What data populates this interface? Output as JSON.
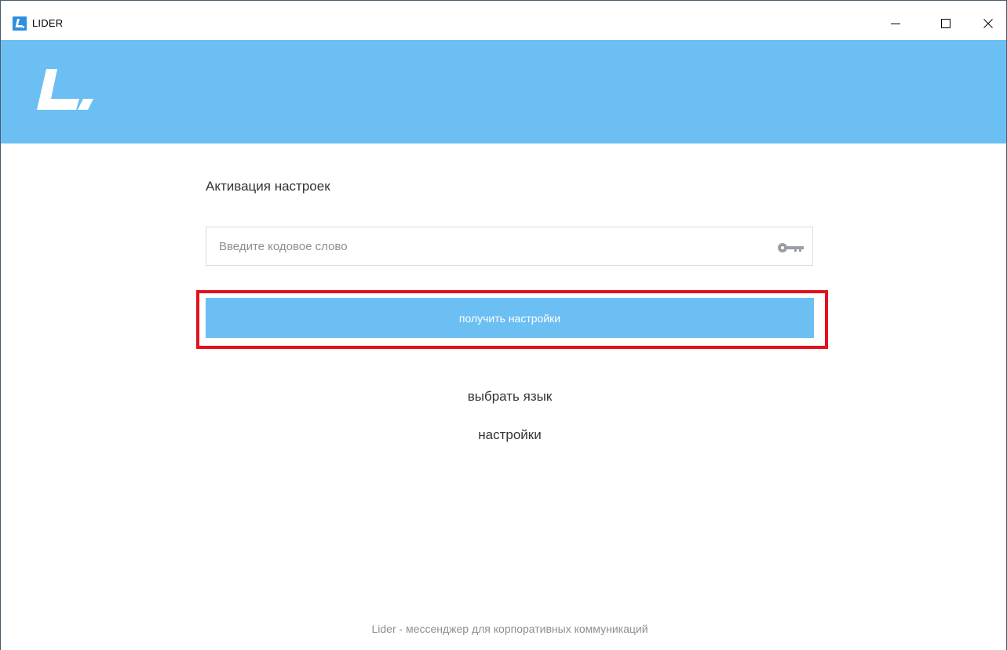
{
  "window": {
    "title": "LIDER",
    "minimize_icon": "minimize-icon",
    "maximize_icon": "maximize-icon",
    "close_icon": "close-icon"
  },
  "header": {
    "logo_icon": "lider-logo",
    "background_color": "#6bbff3"
  },
  "activation": {
    "title": "Активация настроек",
    "code_input": {
      "value": "",
      "placeholder": "Введите кодовое слово",
      "icon": "key-icon"
    },
    "get_settings_button": "получить настройки",
    "choose_language_link": "выбрать язык",
    "settings_link": "настройки"
  },
  "footer": {
    "text": "Lider - мессенджер для корпоративных коммуникаций"
  },
  "colors": {
    "accent": "#6bbff3",
    "highlight": "#e3121c",
    "text": "#333333",
    "muted": "#8a8f94"
  }
}
